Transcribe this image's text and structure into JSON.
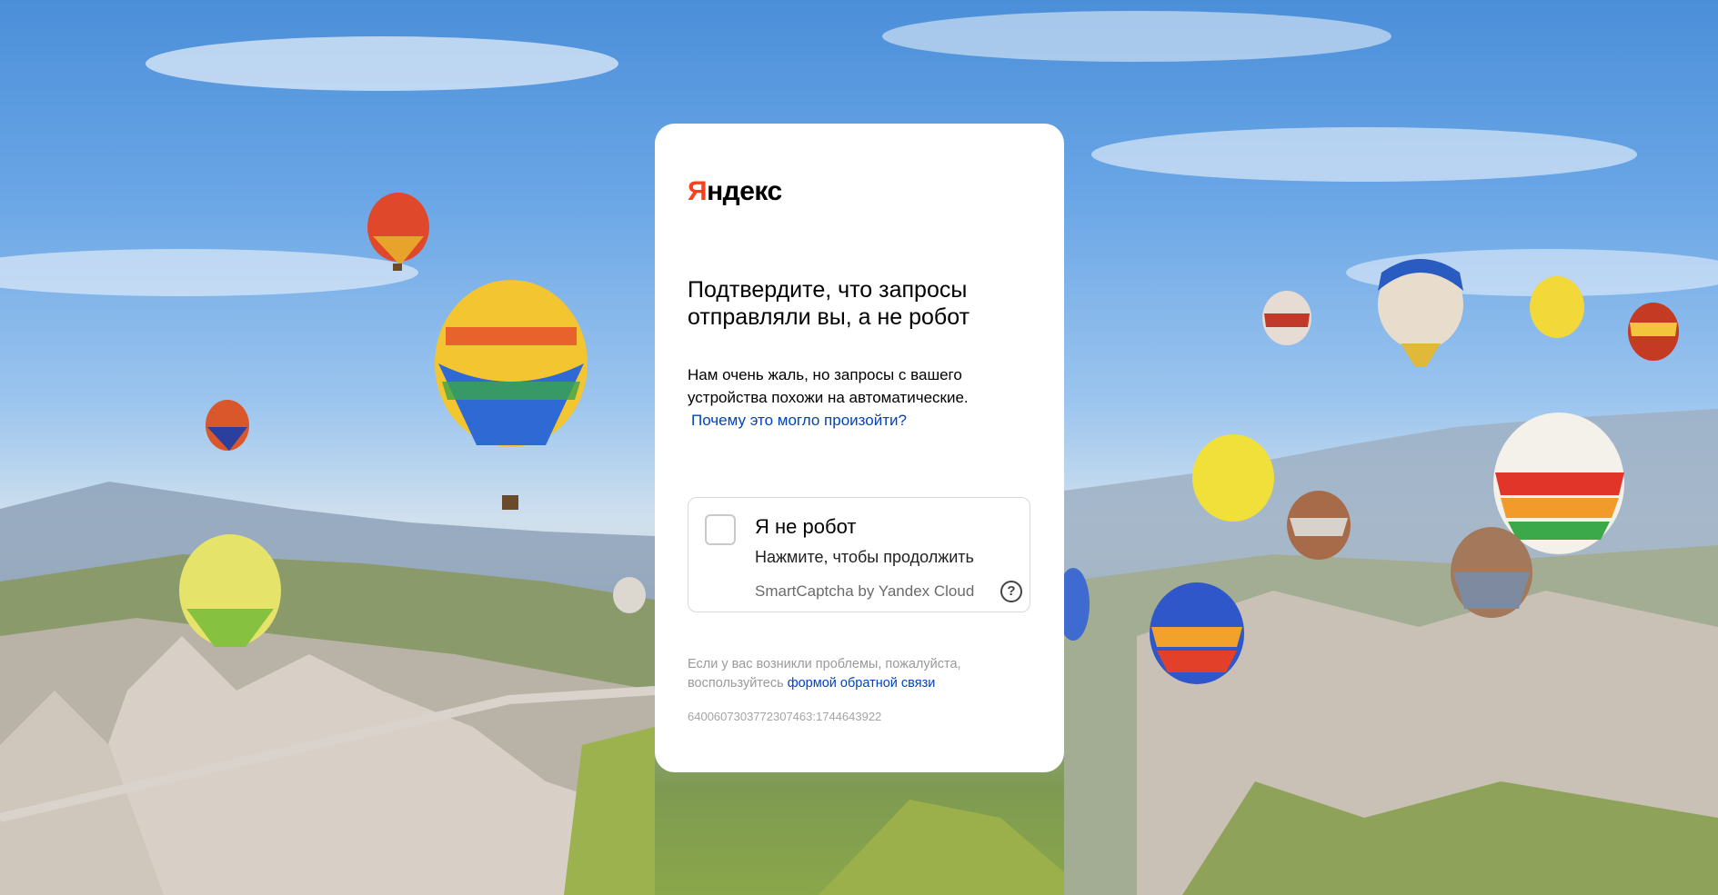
{
  "logo": {
    "first_letter": "Я",
    "rest": "ндекс"
  },
  "title": "Подтвердите, что запросы отправляли вы, а не робот",
  "description": {
    "line1": "Нам очень жаль, но запросы с вашего",
    "line2": "устройства похожи на автоматические.",
    "why_link": "Почему это могло произойти?"
  },
  "captcha": {
    "checkbox_label": "Я не робот",
    "subtitle": "Нажмите, чтобы продолжить",
    "brand": "SmartCaptcha by Yandex Cloud",
    "help_symbol": "?"
  },
  "footer": {
    "text_line1": "Если у вас возникли проблемы, пожалуйста,",
    "text_line2": "воспользуйтесь ",
    "feedback_link": "формой обратной связи",
    "request_id": "6400607303772307463:1744643922"
  },
  "colors": {
    "brand_red": "#fc3f1d",
    "link_blue": "#0044bb"
  }
}
